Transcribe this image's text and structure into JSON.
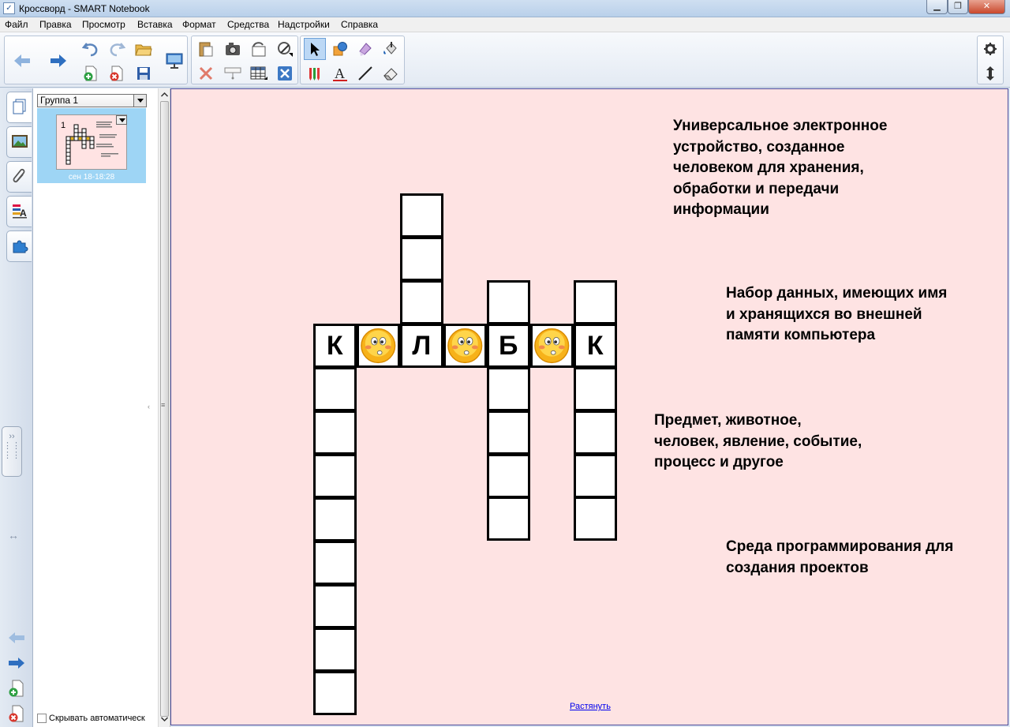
{
  "window": {
    "title": "Кроссворд - SMART Notebook",
    "app_icon": "notebook-app-icon",
    "min_label": "▁",
    "max_label": "❐",
    "close_label": "✕"
  },
  "menu": [
    "Файл",
    "Правка",
    "Просмотр",
    "Вставка",
    "Формат",
    "Средства",
    "Надстройки",
    "Справка"
  ],
  "toolbar": {
    "icons": [
      "back-arrow-icon",
      "forward-arrow-icon",
      "undo-icon",
      "redo-icon",
      "add-page-icon",
      "delete-page-icon",
      "open-folder-icon",
      "save-icon",
      "screen-display-icon",
      "paste-icon",
      "delete-icon",
      "screen-capture-icon",
      "screen-shade-icon",
      "table-icon",
      "magic-pen-icon",
      "full-screen-icon",
      "select-arrow-icon",
      "shapes-icon",
      "pens-icon",
      "text-icon",
      "eraser-icon",
      "line-icon",
      "fill-icon",
      "creative-pen-icon",
      "gear-icon",
      "move-toolbar-icon"
    ]
  },
  "side_tabs": [
    "page-sorter-icon",
    "gallery-icon",
    "attachments-icon",
    "properties-icon",
    "addons-icon"
  ],
  "sorter": {
    "group_label": "Группа 1",
    "page_number": "1",
    "page_date": "сен 18-18:28",
    "autohide_label": "Скрывать автоматическ"
  },
  "crossword": {
    "row_letters": [
      "К",
      "",
      "Л",
      "",
      "Б",
      "",
      "К"
    ],
    "smiley_positions": [
      1,
      3,
      5
    ]
  },
  "clues": [
    "Универсальное электронное\nустройство, созданное\nчеловеком для хранения,\nобработки и передачи\nинформации",
    "Набор данных, имеющих имя\nи хранящихся во внешней\nпамяти компьютера",
    "Предмет, животное,\nчеловек, явление, событие,\nпроцесс и другое",
    "Среда программирования для\nсоздания проектов"
  ],
  "stretch_link": "Растянуть",
  "colors": {
    "canvas_bg": "#fee3e3",
    "selected_thumb": "#9ed5f5",
    "link": "#0000ee"
  }
}
